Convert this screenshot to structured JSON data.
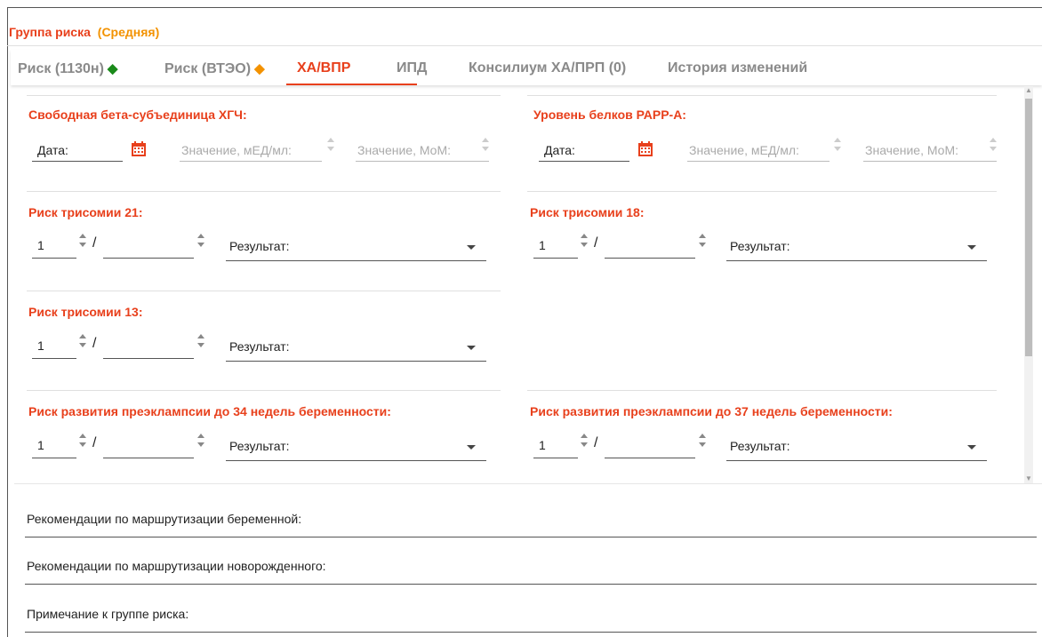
{
  "header": {
    "title": "Группа риска",
    "level": "(Средняя)"
  },
  "colors": {
    "accent": "#e8401c",
    "level": "#f39200",
    "green_diamond": "#1a8a1a",
    "orange_diamond": "#f39200"
  },
  "tabs": [
    {
      "label": "Риск (1130н)",
      "badge": "◆"
    },
    {
      "label": "Риск (ВТЭО)",
      "badge": "◆"
    },
    {
      "label": "ХА/ВПР"
    },
    {
      "label": "ИПД"
    },
    {
      "label": "Консилиум ХА/ПРП (0)"
    },
    {
      "label": "История изменений"
    }
  ],
  "active_tab": "ХА/ВПР",
  "sections": {
    "beta_hcg": {
      "title": "Свободная бета-субъединица ХГЧ:",
      "date_label": "Дата:",
      "value_placeholder": "Значение, мЕД/мл:",
      "mom_placeholder": "Значение, МоМ:"
    },
    "papp_a": {
      "title": "Уровень белков РАРР-А:",
      "date_label": "Дата:",
      "value_placeholder": "Значение, мЕД/мл:",
      "mom_placeholder": "Значение, МоМ:"
    },
    "trisomy21": {
      "title": "Риск трисомии 21:",
      "numerator": "1",
      "result_label": "Результат:"
    },
    "trisomy18": {
      "title": "Риск трисомии 18:",
      "numerator": "1",
      "result_label": "Результат:"
    },
    "trisomy13": {
      "title": "Риск трисомии 13:",
      "numerator": "1",
      "result_label": "Результат:"
    },
    "preeclampsia34": {
      "title": "Риск развития преэклампсии до 34 недель беременности:",
      "numerator": "1",
      "result_label": "Результат:"
    },
    "preeclampsia37": {
      "title": "Риск развития преэклампсии до 37 недель беременности:",
      "numerator": "1",
      "result_label": "Результат:"
    }
  },
  "bottom": {
    "routing_pregnant": "Рекомендации по маршрутизации беременной:",
    "routing_newborn": "Рекомендации по маршрутизации новорожденного:",
    "risk_note": "Примечание к группе риска:"
  }
}
